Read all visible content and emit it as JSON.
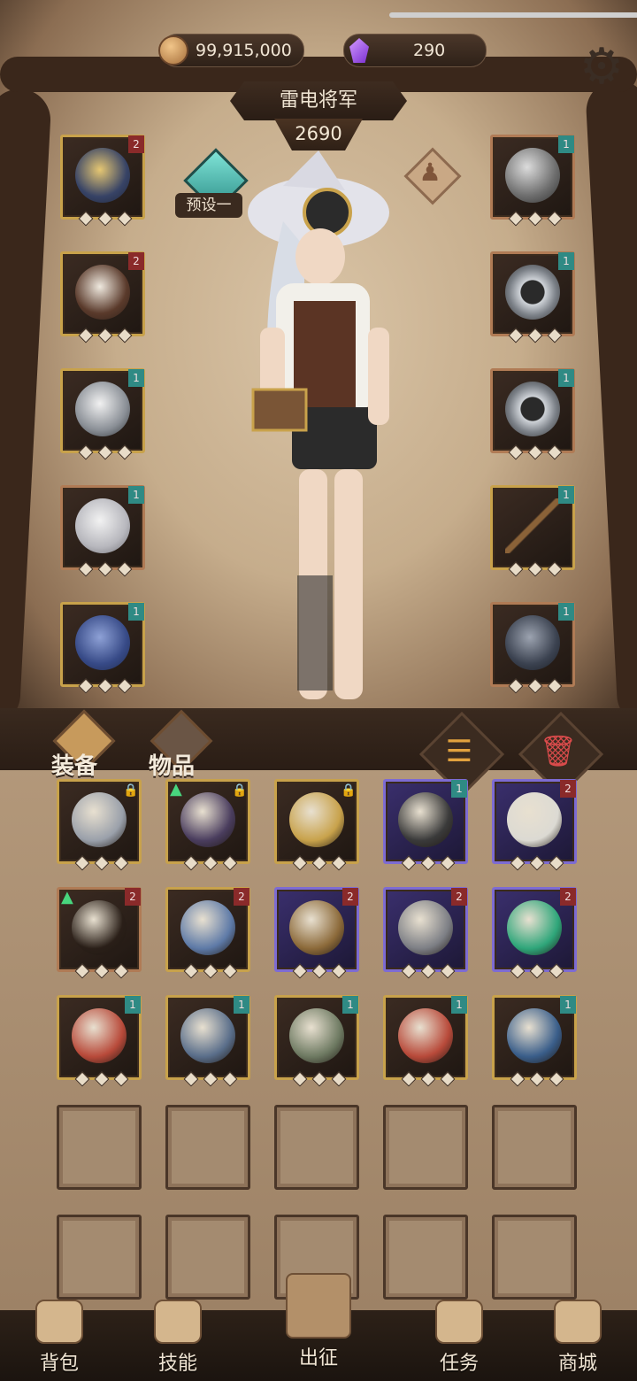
{
  "currency": {
    "gold": "99,915,000",
    "gems": "290"
  },
  "hero": {
    "name": "雷电将军",
    "power": "2690",
    "preset_label": "预设一"
  },
  "tabs": {
    "equipment": "装备",
    "items": "物品"
  },
  "equipment_left": [
    {
      "item": "hood",
      "level": "2"
    },
    {
      "item": "vest",
      "level": "2"
    },
    {
      "item": "gauntlet",
      "level": "1"
    },
    {
      "item": "pants",
      "level": "1"
    },
    {
      "item": "boots",
      "level": "1"
    }
  ],
  "equipment_right": [
    {
      "item": "helm",
      "level": "1"
    },
    {
      "item": "ring",
      "level": "1"
    },
    {
      "item": "ring",
      "level": "1"
    },
    {
      "item": "staff",
      "level": "1"
    },
    {
      "item": "wolf-mask",
      "level": "1"
    }
  ],
  "inventory": [
    {
      "item": "chain-armor",
      "locked": true
    },
    {
      "item": "chain-orb",
      "locked": true,
      "upgrade": true
    },
    {
      "item": "spellbook",
      "locked": true
    },
    {
      "item": "claw-glove",
      "level": "1"
    },
    {
      "item": "boots",
      "level": "2"
    },
    {
      "item": "empty-frame",
      "level": "2",
      "upgrade": true
    },
    {
      "item": "orb-staff",
      "level": "2"
    },
    {
      "item": "owl-ring",
      "level": "2"
    },
    {
      "item": "broken-ring",
      "level": "2"
    },
    {
      "item": "pendant",
      "level": "2"
    },
    {
      "item": "tome",
      "level": "1"
    },
    {
      "item": "shadow-armor",
      "level": "1"
    },
    {
      "item": "ghost-cloak",
      "level": "1"
    },
    {
      "item": "tome",
      "level": "1"
    },
    {
      "item": "star-book",
      "level": "1"
    }
  ],
  "nav": [
    {
      "label": "背包"
    },
    {
      "label": "技能"
    },
    {
      "label": "出征"
    },
    {
      "label": "任务"
    },
    {
      "label": "商城"
    }
  ],
  "colors": {
    "gold_frame": "#c8a24b",
    "purple_frame": "#7d6bd3",
    "bronze_frame": "#b07b55",
    "level_red": "#8a2a2a",
    "level_teal": "#2f8a84"
  }
}
